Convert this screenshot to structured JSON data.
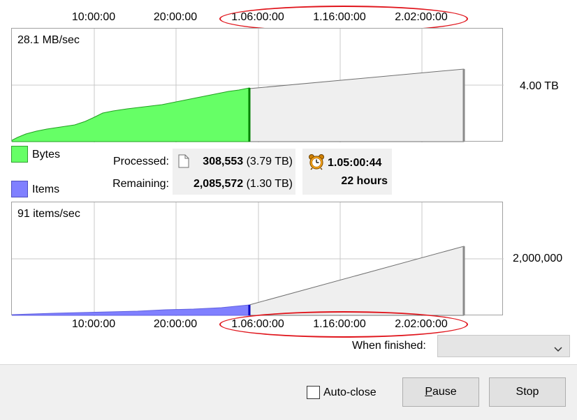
{
  "time_axis": {
    "ticks": [
      "10:00:00",
      "20:00:00",
      "1.06:00:00",
      "1.16:00:00",
      "2.02:00:00"
    ]
  },
  "bytes_graph": {
    "rate": "28.1 MB/sec",
    "scale": "4.00 TB",
    "done_color": "#66ff66",
    "done_edge": "#008000",
    "projected_color": "#efefef"
  },
  "items_graph": {
    "rate": "91 items/sec",
    "scale": "2,000,000",
    "done_color": "#8080ff",
    "done_edge": "#0000c0",
    "projected_color": "#efefef"
  },
  "legend": {
    "bytes": "Bytes",
    "items": "Items",
    "bytes_color": "#66ff66",
    "items_color": "#8080ff"
  },
  "stats": {
    "processed_label": "Processed:",
    "remaining_label": "Remaining:",
    "processed_count": "308,553",
    "processed_size": "(3.79 TB)",
    "remaining_count": "2,085,572",
    "remaining_size": "(1.30 TB)",
    "elapsed": "1.05:00:44",
    "remaining_time": "22 hours",
    "file_icon": "document-icon",
    "clock_icon": "alarm-clock-icon"
  },
  "when_finished": {
    "label": "When finished:",
    "value": ""
  },
  "auto_close": {
    "label": "Auto-close",
    "checked": false
  },
  "buttons": {
    "pause_prefix": "",
    "pause_mnemonic": "P",
    "pause_rest": "ause",
    "stop": "Stop"
  },
  "annotation_color": "#e0141b"
}
